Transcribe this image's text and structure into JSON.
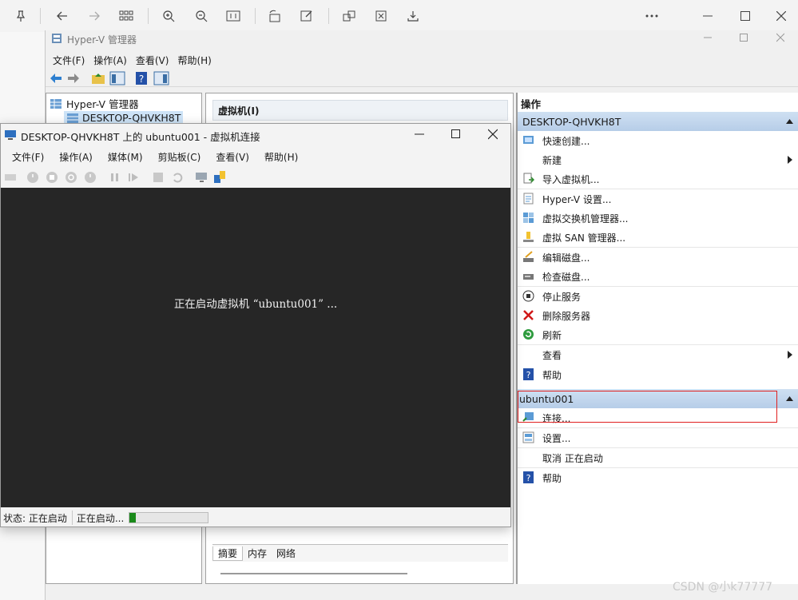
{
  "viewer": {
    "icons": [
      "pin-icon",
      "back-icon",
      "forward-icon",
      "grid-icon",
      "zoom-in-icon",
      "zoom-out-icon",
      "fit-icon",
      "rotate-icon",
      "edit-icon",
      "share-icon",
      "crop-icon",
      "save-icon",
      "more-icon",
      "minimize-icon",
      "maximize-icon",
      "close-icon"
    ]
  },
  "hyperv": {
    "title": "Hyper-V 管理器",
    "menu": [
      "文件(F)",
      "操作(A)",
      "查看(V)",
      "帮助(H)"
    ],
    "tree": {
      "root": "Hyper-V 管理器",
      "host": "DESKTOP-QHVKH8T"
    },
    "center": {
      "section_title": "虚拟机(I)",
      "tabs": [
        "摘要",
        "内存",
        "网络"
      ]
    },
    "actions": {
      "title": "操作",
      "host_header": "DESKTOP-QHVKH8T",
      "host_items": [
        "快速创建...",
        "新建",
        "导入虚拟机...",
        "Hyper-V 设置...",
        "虚拟交换机管理器...",
        "虚拟 SAN 管理器...",
        "编辑磁盘...",
        "检查磁盘...",
        "停止服务",
        "删除服务器",
        "刷新",
        "查看",
        "帮助"
      ],
      "vm_header": "ubuntu001",
      "vm_items": [
        "连接...",
        "设置...",
        "取消 正在启动",
        "帮助"
      ]
    }
  },
  "vmconnect": {
    "title": "DESKTOP-QHVKH8T 上的 ubuntu001 - 虚拟机连接",
    "menu": [
      "文件(F)",
      "操作(A)",
      "媒体(M)",
      "剪贴板(C)",
      "查看(V)",
      "帮助(H)"
    ],
    "screen_message": "正在启动虚拟机 “ubuntu001” ...",
    "status_label": "状态: 正在启动",
    "status_progress_text": "正在启动...",
    "progress_fraction": 0.08
  },
  "watermark": "CSDN @小k77777",
  "colors": {
    "highlight_box": "#e02020",
    "progress": "#1a8a1a",
    "header_blue": "#c4d8ef"
  }
}
